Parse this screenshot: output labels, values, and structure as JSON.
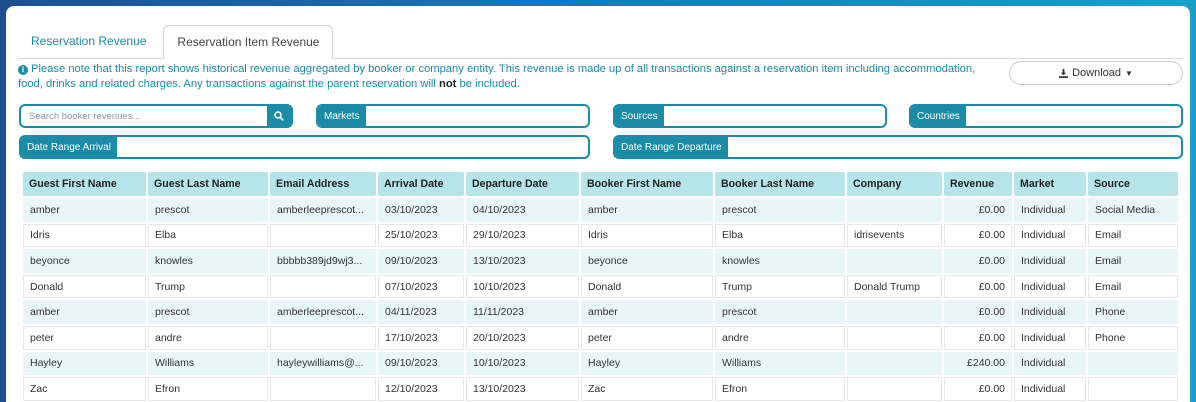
{
  "tabs": [
    {
      "label": "Reservation Revenue",
      "active": false
    },
    {
      "label": "Reservation Item Revenue",
      "active": true
    }
  ],
  "note": {
    "text_before": "Please note that this report shows historical revenue aggregated by booker or company entity. This revenue is made up of all transactions against a reservation item including accommodation, food, drinks and related charges. Any transactions against the parent reservation will ",
    "bold": "not",
    "text_after": " be included."
  },
  "download_label": "Download",
  "search": {
    "placeholder": "Search booker revenues..."
  },
  "filters": {
    "markets": "Markets",
    "sources": "Sources",
    "countries": "Countries",
    "arrival": "Date Range Arrival",
    "departure": "Date Range Departure"
  },
  "table": {
    "columns": [
      "Guest First Name",
      "Guest Last Name",
      "Email Address",
      "Arrival Date",
      "Departure Date",
      "Booker First Name",
      "Booker Last Name",
      "Company",
      "Revenue",
      "Market",
      "Source"
    ],
    "rows": [
      [
        "amber",
        "prescot",
        "amberleeprescot...",
        "03/10/2023",
        "04/10/2023",
        "amber",
        "prescot",
        "",
        "£0.00",
        "Individual",
        "Social Media"
      ],
      [
        "Idris",
        "Elba",
        "",
        "25/10/2023",
        "29/10/2023",
        "Idris",
        "Elba",
        "idrisevents",
        "£0.00",
        "Individual",
        "Email"
      ],
      [
        "beyonce",
        "knowles",
        "bbbbb389jd9wj3...",
        "09/10/2023",
        "13/10/2023",
        "beyonce",
        "knowles",
        "",
        "£0.00",
        "Individual",
        "Email"
      ],
      [
        "Donald",
        "Trump",
        "",
        "07/10/2023",
        "10/10/2023",
        "Donald",
        "Trump",
        "Donald Trump",
        "£0.00",
        "Individual",
        "Email"
      ],
      [
        "amber",
        "prescot",
        "amberleeprescot...",
        "04/11/2023",
        "11/11/2023",
        "amber",
        "prescot",
        "",
        "£0.00",
        "Individual",
        "Phone"
      ],
      [
        "peter",
        "andre",
        "",
        "17/10/2023",
        "20/10/2023",
        "peter",
        "andre",
        "",
        "£0.00",
        "Individual",
        "Phone"
      ],
      [
        "Hayley",
        "Williams",
        "hayleywilliams@...",
        "09/10/2023",
        "10/10/2023",
        "Hayley",
        "Williams",
        "",
        "£240.00",
        "Individual",
        ""
      ],
      [
        "Zac",
        "Efron",
        "",
        "12/10/2023",
        "13/10/2023",
        "Zac",
        "Efron",
        "",
        "£0.00",
        "Individual",
        ""
      ]
    ]
  },
  "colors": {
    "accent": "#1a8ca8",
    "header_bg": "#b5e4ea",
    "row_alt": "#e9f6f8"
  }
}
